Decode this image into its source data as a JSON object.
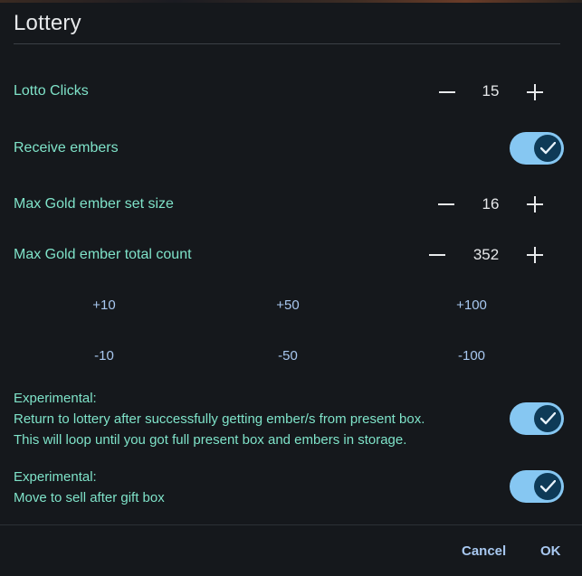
{
  "dialog": {
    "title": "Lottery",
    "lotto_clicks": {
      "label": "Lotto Clicks",
      "value": "15"
    },
    "receive_embers": {
      "label": "Receive embers",
      "checked": true
    },
    "max_gold_set_size": {
      "label": "Max Gold ember set size",
      "value": "16"
    },
    "max_gold_total_count": {
      "label": "Max Gold ember total count",
      "value": "352"
    },
    "increments": [
      "+10",
      "+50",
      "+100"
    ],
    "decrements": [
      "-10",
      "-50",
      "-100"
    ],
    "experimental_return": {
      "line1": "Experimental:",
      "line2": "Return to lottery after successfully getting ember/s from present box.",
      "line3": "This will loop until you got full present box and embers in storage.",
      "checked": true
    },
    "experimental_sell": {
      "line1": "Experimental:",
      "line2": "Move to sell after gift box",
      "checked": true
    },
    "actions": {
      "cancel": "Cancel",
      "ok": "OK"
    }
  },
  "colors": {
    "background": "#15181c",
    "label_text": "#7fe3c9",
    "toggle_track": "#86c7f2",
    "toggle_knob": "#0e3a57",
    "action_text": "#a8c8f0"
  },
  "icons": [
    "minus-icon",
    "plus-icon",
    "check-icon"
  ]
}
